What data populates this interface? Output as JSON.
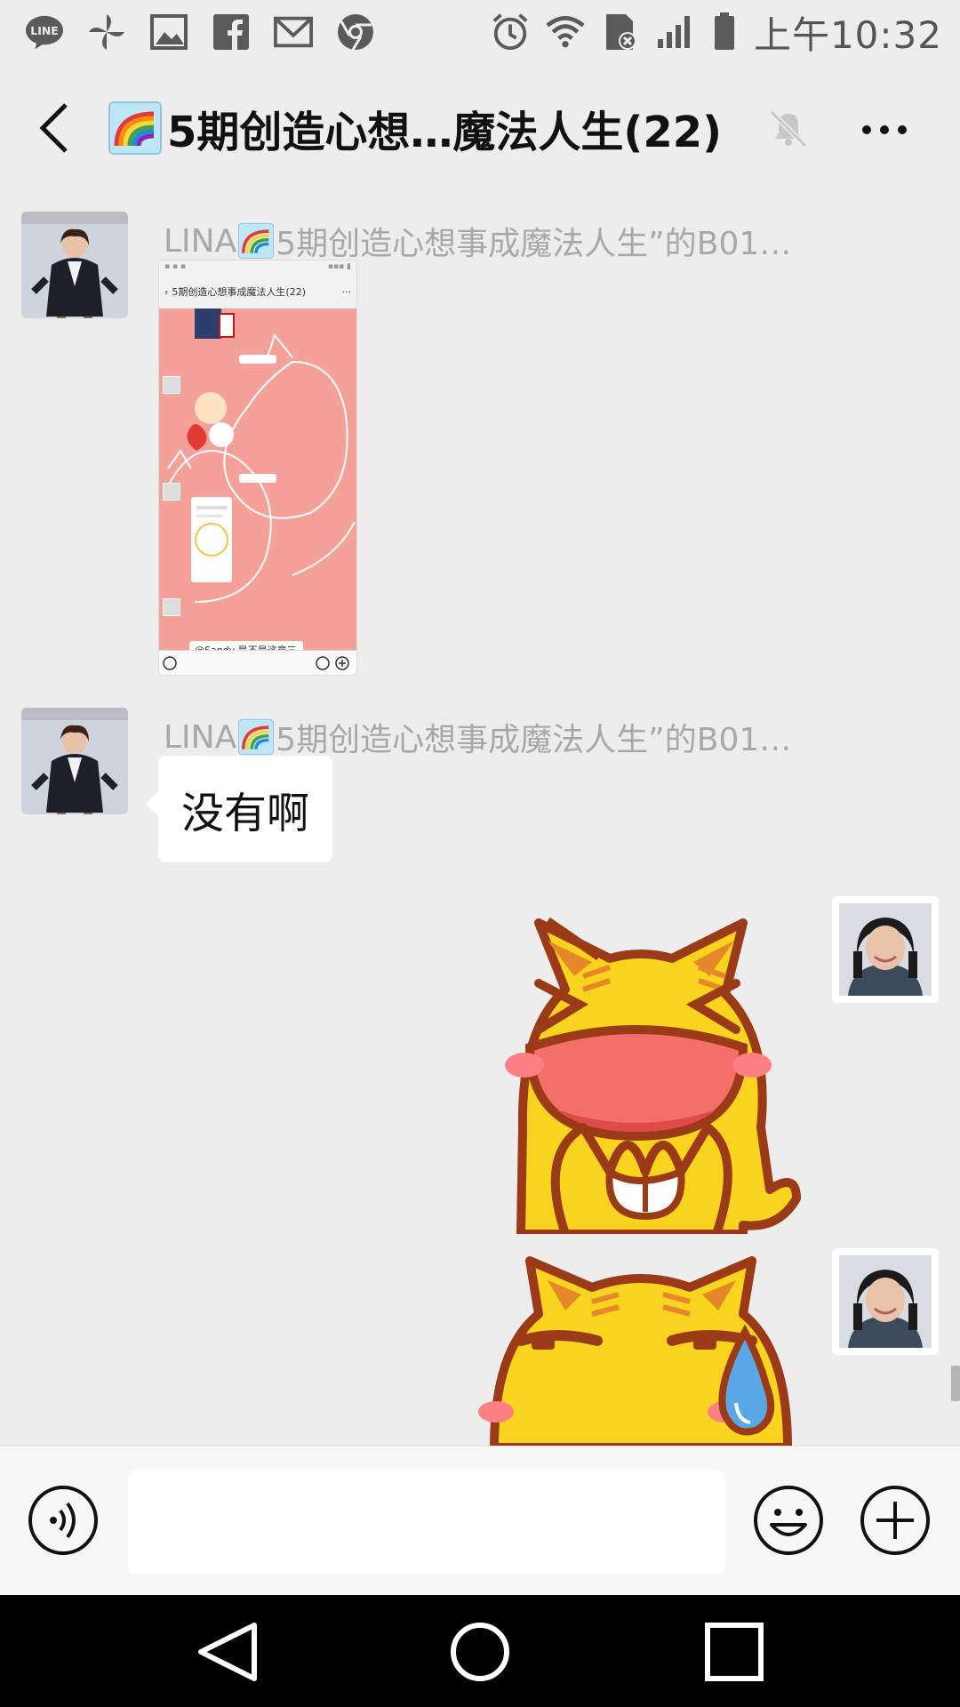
{
  "status_bar": {
    "left_icons": [
      "line-app-icon",
      "pinwheel-icon",
      "gallery-icon",
      "facebook-icon",
      "gmail-icon",
      "chrome-icon"
    ],
    "right_icons": [
      "alarm-icon",
      "wifi-icon",
      "sd-card-icon",
      "signal-icon",
      "battery-icon"
    ],
    "time": "上午10:32"
  },
  "header": {
    "title": "5期创造心想…魔法人生(22)",
    "title_emoji": "rainbow-icon",
    "muted": true
  },
  "messages": [
    {
      "sender": "LINA",
      "sender_suffix": "5期创造心想事成魔法人生”的B01…",
      "type": "image",
      "image": {
        "header_title": "5期创造心想事成魔法人生(22)",
        "inner_message": "@Sandy 是不是这章三部没有发行？"
      }
    },
    {
      "sender": "LINA",
      "sender_suffix": "5期创造心想事成魔法人生”的B01…",
      "type": "text",
      "text": "没有啊"
    },
    {
      "sender": "self",
      "type": "sticker",
      "sticker": "laughing-yellow-cat-sticker"
    },
    {
      "sender": "self",
      "type": "sticker",
      "sticker": "sweating-yellow-cat-sticker"
    }
  ],
  "input_bar": {
    "placeholder": "",
    "value": ""
  },
  "colors": {
    "background": "#ededed",
    "bubble": "#ffffff",
    "sticker_yellow": "#f9d41f",
    "sticker_outline": "#9b3a16",
    "screenshot_pink": "#f4a19a"
  }
}
